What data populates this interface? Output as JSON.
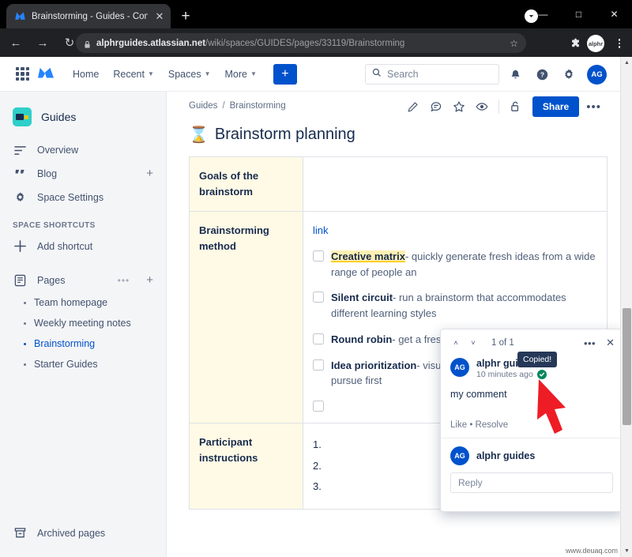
{
  "browser": {
    "tab": {
      "title": "Brainstorming - Guides - Conflue",
      "favicon": "atlassian-icon",
      "close": "✕"
    },
    "newtab_label": "+",
    "window": {
      "minimize": "—",
      "maximize": "□",
      "close": "✕",
      "chevron": "▼"
    },
    "nav": {
      "back": "←",
      "forward": "→",
      "reload": "↻"
    },
    "url": {
      "host": "alphrguides.atlassian.net",
      "path": "/wiki/spaces/GUIDES/pages/33119/Brainstorming",
      "lock": "lock-icon"
    },
    "bookmark_star": "☆",
    "extensions": "puzzle-icon",
    "profile_initials": "alphr",
    "menu": "kebab-icon"
  },
  "confluence_nav": {
    "apps_grid": "apps-grid-icon",
    "logo": "confluence-logo",
    "items": [
      {
        "label": "Home",
        "caret": false
      },
      {
        "label": "Recent",
        "caret": true
      },
      {
        "label": "Spaces",
        "caret": true
      },
      {
        "label": "More",
        "caret": true
      }
    ],
    "create_label": "+",
    "search": {
      "placeholder": "Search",
      "value": "",
      "icon": "search-icon"
    },
    "notifications": "bell-icon",
    "help": "help-icon",
    "settings": "gear-icon",
    "avatar": "AG"
  },
  "sidebar": {
    "space": {
      "name": "Guides",
      "icon": "space-icon"
    },
    "items": [
      {
        "label": "Overview",
        "icon": "overview-icon",
        "plus": false
      },
      {
        "label": "Blog",
        "icon": "blog-icon",
        "plus": true
      },
      {
        "label": "Space Settings",
        "icon": "settings-icon",
        "plus": false
      }
    ],
    "shortcuts_header": "SPACE SHORTCUTS",
    "add_shortcut": {
      "label": "Add shortcut",
      "icon": "plus-icon"
    },
    "pages": {
      "label": "Pages",
      "icon": "pages-icon",
      "dots": "•••",
      "plus": "+"
    },
    "page_tree": [
      {
        "label": "Team homepage",
        "active": false
      },
      {
        "label": "Weekly meeting notes",
        "active": false
      },
      {
        "label": "Brainstorming",
        "active": true
      },
      {
        "label": "Starter Guides",
        "active": false
      }
    ],
    "archived": {
      "label": "Archived pages",
      "icon": "archive-icon"
    }
  },
  "page": {
    "breadcrumb": [
      "Guides",
      "Brainstorming"
    ],
    "breadcrumb_sep": "/",
    "tools": [
      {
        "name": "edit-icon",
        "glyph": "pencil"
      },
      {
        "name": "comment-icon",
        "glyph": "comment"
      },
      {
        "name": "star-icon",
        "glyph": "star"
      },
      {
        "name": "watch-icon",
        "glyph": "eye"
      },
      {
        "name": "restrictions-icon",
        "glyph": "unlock"
      }
    ],
    "share_label": "Share",
    "more_label": "•••",
    "title": "Brainstorm planning",
    "title_emoji": "⌛",
    "table": {
      "rows": [
        {
          "header": "Goals of the brainstorm",
          "type": "empty",
          "body": ""
        },
        {
          "header": "Brainstorming method",
          "type": "tasks",
          "link": "link",
          "tasks": [
            {
              "term": "Creative matrix",
              "highlighted": true,
              "text": "- quickly generate fresh ideas from a wide range of people an"
            },
            {
              "term": "Silent circuit",
              "highlighted": false,
              "text": "- run a brainstorm that accommodates different learning styles"
            },
            {
              "term": "Round robin",
              "highlighted": false,
              "text": "- get a fresh take on ideas"
            },
            {
              "term": "Idea prioritization",
              "highlighted": false,
              "text": "- visualize which ideas you should pursue first"
            },
            {
              "term": "",
              "highlighted": false,
              "text": ""
            }
          ]
        },
        {
          "header": "Participant instructions",
          "type": "ordered",
          "items": [
            "1.",
            "2.",
            "3."
          ]
        }
      ]
    }
  },
  "comment_popover": {
    "prev": "˄",
    "next": "˅",
    "counter": "1 of 1",
    "options": "•••",
    "close": "✕",
    "author": {
      "name": "alphr guides",
      "initials": "AG",
      "time": "10 minutes ago",
      "status_icon": "green-check-icon"
    },
    "body": "my comment",
    "actions": {
      "like": "Like",
      "sep": "•",
      "resolve": "Resolve"
    },
    "reply_author": {
      "name": "alphr guides",
      "initials": "AG"
    },
    "reply_placeholder": "Reply",
    "reply_value": ""
  },
  "tooltip": {
    "text": "Copied!"
  },
  "cursor": {
    "type": "arrow-pointer",
    "color": "#ee1c25"
  },
  "scrollbar": {
    "up": "▲",
    "down": "▼"
  },
  "watermark": {
    "text": "www.deuaq.com"
  },
  "colors": {
    "accent": "#0052cc",
    "header_cell": "#fffae6",
    "highlight": "#fff0b3",
    "success": "#00875a",
    "tooltip_bg": "#253858",
    "cursor_red": "#ee1c25",
    "space_icon": "#2ecfc9"
  }
}
